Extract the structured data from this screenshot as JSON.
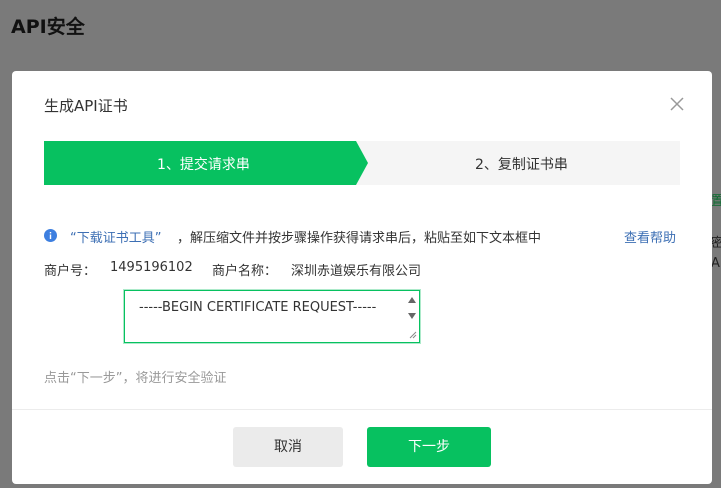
{
  "page": {
    "title": "API安全",
    "peek_chars": [
      "置",
      "密",
      "A"
    ]
  },
  "modal": {
    "title": "生成API证书",
    "steps": [
      {
        "label": "1、提交请求串",
        "active": true
      },
      {
        "label": "2、复制证书串",
        "active": false
      }
    ],
    "info": {
      "tool_link": "“下载证书工具”",
      "text": "，解压缩文件并按步骤操作获得请求串后，粘贴至如下文本框中",
      "help_link": "查看帮助"
    },
    "merchant": {
      "id_label": "商户号：",
      "id_value": "1495196102",
      "name_label": "商户名称：",
      "name_value": "深圳赤道娱乐有限公司"
    },
    "csr_value": "-----BEGIN CERTIFICATE REQUEST-----",
    "hint": "点击“下一步”，将进行安全验证",
    "buttons": {
      "cancel": "取消",
      "next": "下一步"
    }
  },
  "colors": {
    "accent": "#07c160",
    "link": "#3d6fb4",
    "overlay": "#7a7a7a"
  }
}
